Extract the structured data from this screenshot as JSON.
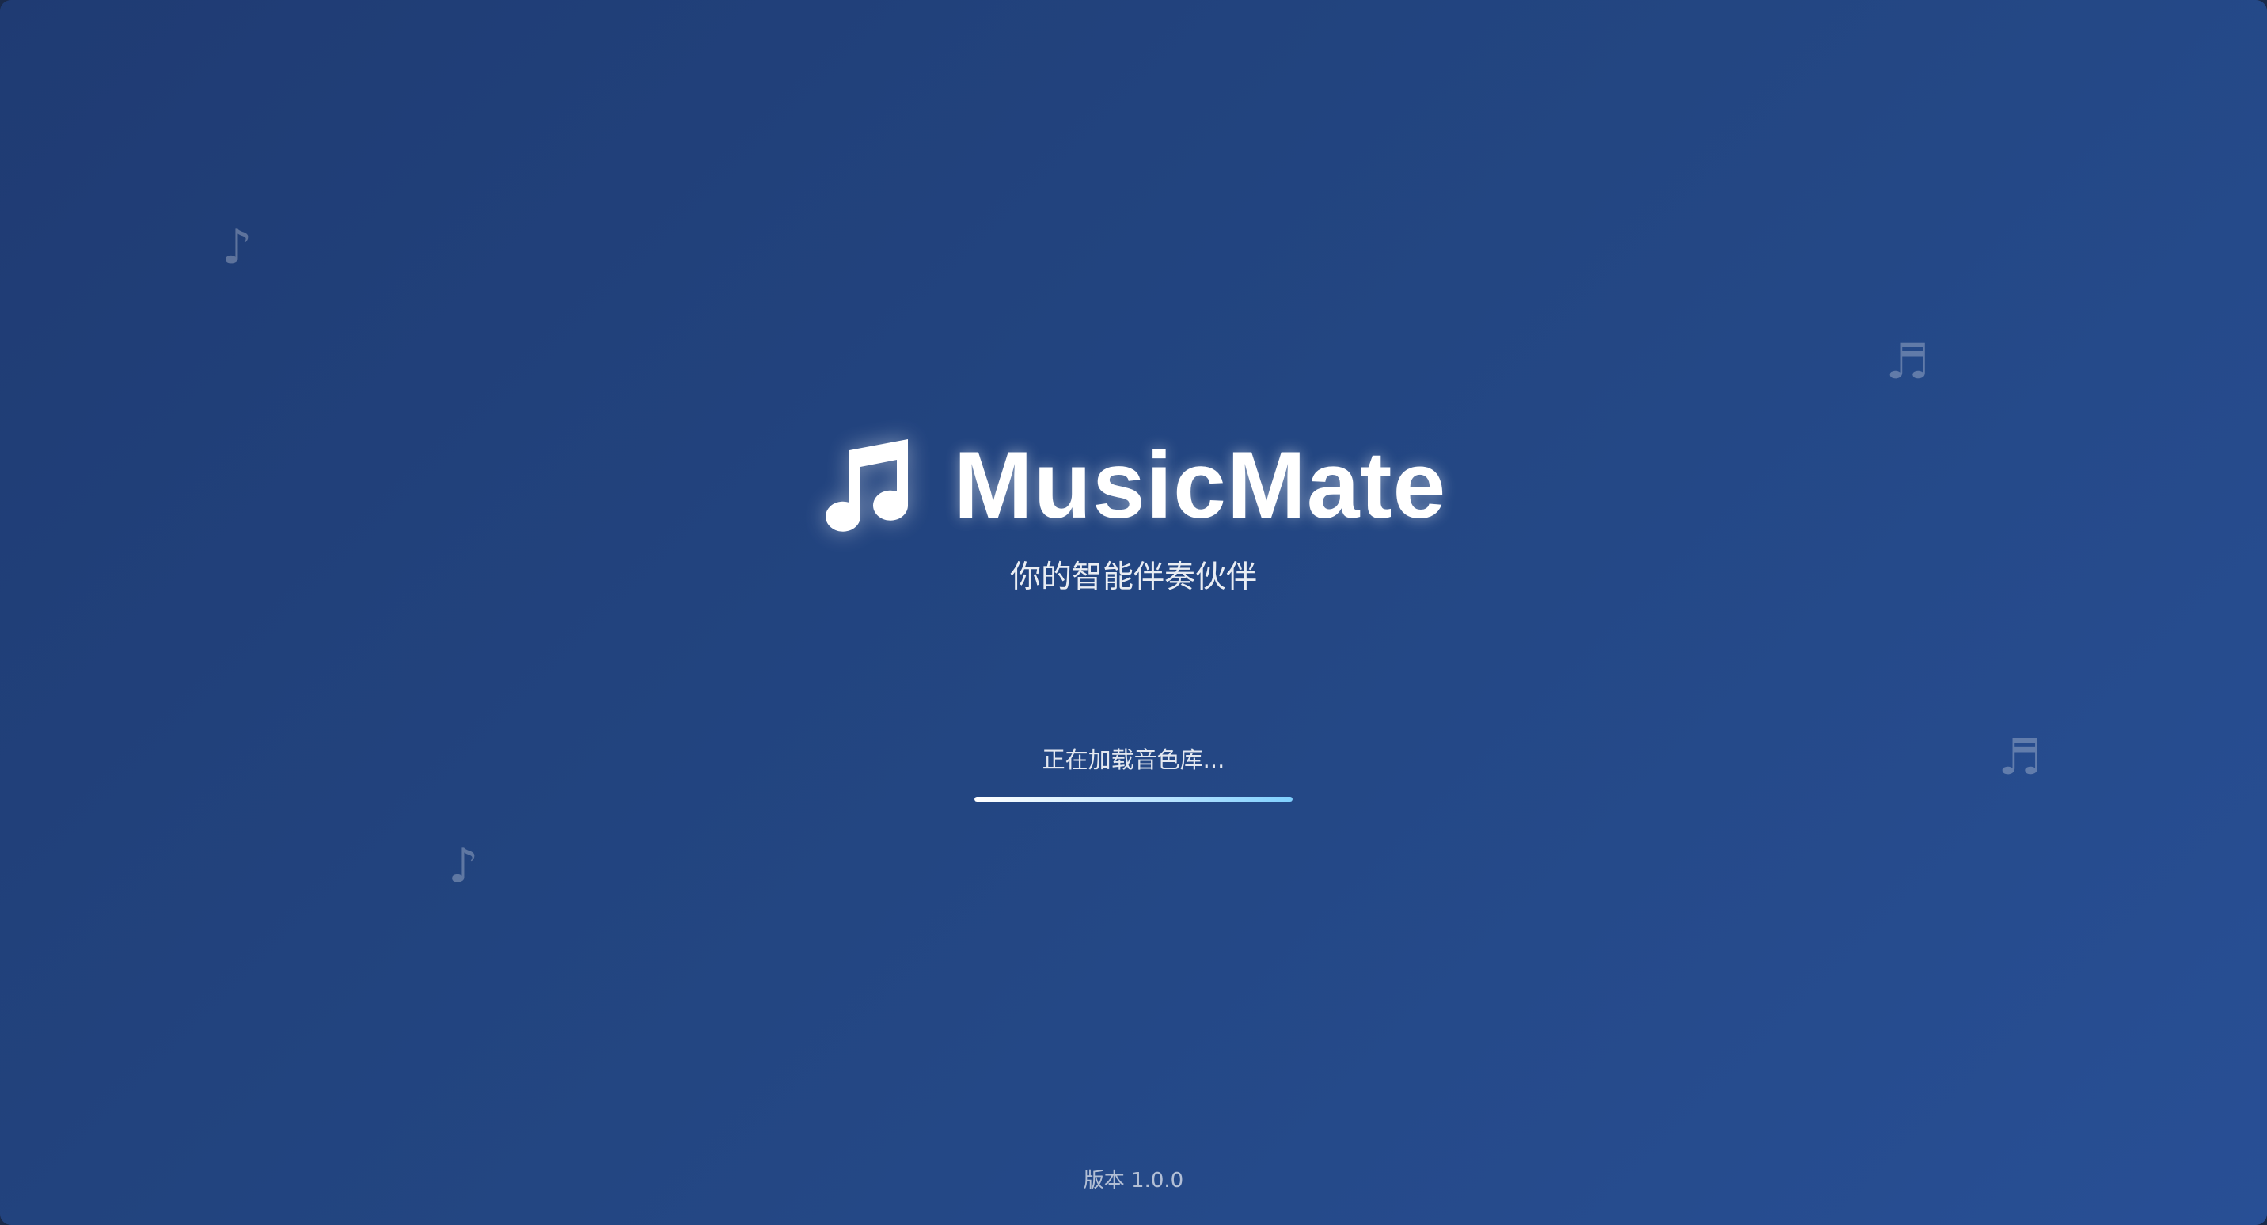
{
  "app": {
    "title": "MusicMate",
    "tagline": "你的智能伴奏伙伴",
    "logo_icon": "music-note-icon"
  },
  "loading": {
    "status_text": "正在加载音色库...",
    "progress": 1.0
  },
  "footer": {
    "version": "版本 1.0.0"
  },
  "decorations": {
    "notes": [
      {
        "glyph": "♪",
        "icon": "eighth-note-icon"
      },
      {
        "glyph": "♬",
        "icon": "beamed-notes-icon"
      },
      {
        "glyph": "♬",
        "icon": "beamed-notes-icon"
      },
      {
        "glyph": "♪",
        "icon": "eighth-note-icon"
      }
    ]
  },
  "colors": {
    "background_start": "#1f3b73",
    "background_end": "#284f95",
    "progress_fill": "#7fd0ff",
    "text": "#ffffff"
  }
}
